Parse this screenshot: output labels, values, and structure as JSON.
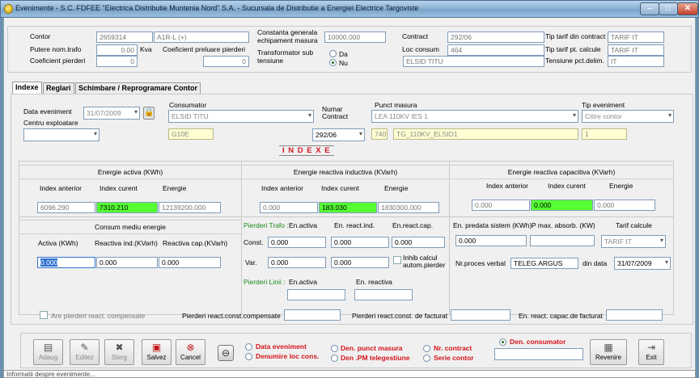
{
  "window": {
    "title": "Evenimente - S.C. FDFEE \"Electrica Distributie Muntenia Nord\" S.A. - Sucursala de Distributie a Energiei Electrice Targoviste",
    "min": "–",
    "max": "□",
    "close": "✕"
  },
  "header": {
    "contor_label": "Contor",
    "contor_value": "2659314",
    "contor_type": "A1R-L (+)",
    "putere_label": "Putere nom.trafo",
    "putere_value": "0.00",
    "putere_unit": "Kva",
    "coef_preluare_label": "Coeficient preluare pierderi",
    "coef_preluare_value": "0",
    "coef_pierderi_label": "Coeficient pierderi",
    "coef_pierderi_value": "0",
    "constanta_label_1": "Constanta generala",
    "constanta_label_2": "echipament masura",
    "constanta_value": "10000.000",
    "trafo_label_1": "Transformator sub",
    "trafo_label_2": "tensiune",
    "trafo_da": "Da",
    "trafo_nu": "Nu",
    "contract_label": "Contract",
    "contract_value": "292/06",
    "loc_consum_label": "Loc consum",
    "loc_consum_value": "464",
    "loc_consum_name": "ELSID TITU",
    "tip_tarif_contract_label": "Tip tarif din contract",
    "tip_tarif_contract_value": "TARIF IT",
    "tip_tarif_calcule_label": "Tip tarif pt. calcule",
    "tip_tarif_calcule_value": "TARIF IT",
    "tensiune_label": "Tensiune pct.delim.",
    "tensiune_value": "IT"
  },
  "tabs": [
    "Indexe",
    "Reglari",
    "Schimbare / Reprogramare Contor"
  ],
  "indexe": {
    "data_eveniment_label": "Data eveniment",
    "data_eveniment_value": "31/07/2009",
    "centru_label": "Centru exploatare",
    "consumator_label": "Consumator",
    "consumator_value": "ELSID TITU",
    "consumator_code": "G10E",
    "numar_contract_label_1": "Numar",
    "numar_contract_label_2": "Contract",
    "numar_contract_value": "292/06",
    "punct_masura_label": "Punct masura",
    "punct_masura_value": "LEA 110KV IES 1",
    "punct_code": "740",
    "punct_name": "TG_110KV_ELSID1",
    "tip_eveniment_label": "Tip eveniment",
    "tip_eveniment_value": "Citire contor",
    "tip_eveniment_code": "1",
    "section_title": "I N D E X E",
    "activa": {
      "title": "Energie activa (KWh)",
      "col_anterior": "Index anterior",
      "col_curent": "Index curent",
      "col_energie": "Energie",
      "anterior": "6096.290",
      "curent": "7310.210",
      "energie": "12139200.000"
    },
    "inductiva": {
      "title": "Energie reactiva inductiva (KVarh)",
      "col_anterior": "Index anterior",
      "col_curent": "Index curent",
      "col_energie": "Energie",
      "anterior": "0.000",
      "curent": "183.030",
      "energie": "1830300.000"
    },
    "capacitiva": {
      "title": "Energie reactiva capacitiva (KVarh)",
      "col_anterior": "Index anterior",
      "col_curent": "Index curent",
      "col_energie": "Energie",
      "anterior": "0.000",
      "curent": "0.000",
      "energie": "0.000"
    },
    "consum": {
      "title": "Consum mediu energie",
      "col_activa": "Activa (KWh)",
      "col_ind": "Reactiva ind.(KVarh)",
      "col_cap": "Reactiva cap.(KVarh)",
      "activa": "0.000",
      "ind": "0.000",
      "cap": "0.000"
    },
    "pierderi_trafo": {
      "title": "Pierderi Trafo :",
      "col_activa": "En.activa",
      "col_ind": "En. react.ind.",
      "col_cap": "En.react.cap.",
      "const_label": "Const.",
      "const_activa": "0.000",
      "const_ind": "0.000",
      "const_cap": "0.000",
      "var_label": "Var.",
      "var_activa": "0.000",
      "var_ind": "0.000",
      "inhib_label_1": "Inhib calcul",
      "inhib_label_2": "autom.pierder"
    },
    "pierderi_linii": {
      "title": "Pierderi Linii :",
      "col_activa": "En.activa",
      "col_reactiva": "En. reactiva"
    },
    "predata": {
      "col_predata": "En. predata sistem (KWh)",
      "col_pmax": "P max. absorb. (KW)",
      "col_tarif": "Tarif calcule",
      "predata": "0.000",
      "tarif": "TARIF IT",
      "proces_label": "Nr.proces verbal",
      "proces_value": "TELEG.ARGUS",
      "din_data_label": "din data",
      "din_data_value": "31/07/2009"
    },
    "footer_row": {
      "compensate_label": "Are pierderi react. compensate",
      "const_comp_label": "Pierderi react.const.compensate",
      "const_fact_label": "Pierderi react.const. de facturat",
      "capac_fact_label": "En. react. capac.de  facturat"
    }
  },
  "toolbar": {
    "adaug": "Adaug",
    "editez": "Editez",
    "sterg": "Sterg",
    "salvez": "Salvez",
    "cancel": "Cancel",
    "revenire": "Revenire",
    "exit": "Exit",
    "sort_options": [
      "Data eveniment",
      "Denumire  loc cons.",
      "Den.  punct masura",
      "Den .PM telegestiune",
      "Nr. contract",
      "Serie contor",
      "Den. consumator"
    ],
    "selected_sort": "Den. consumator"
  },
  "status": {
    "text": "Informatii despre evenimente..."
  }
}
